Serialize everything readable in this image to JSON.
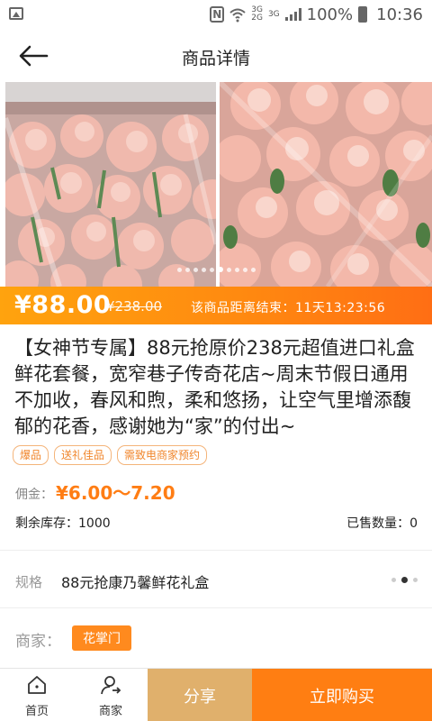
{
  "status_bar": {
    "network": [
      "3G",
      "3G",
      "2G"
    ],
    "battery": "100%",
    "time": "10:36"
  },
  "header": {
    "title": "商品详情"
  },
  "price": {
    "current": "¥88.00",
    "original": "¥238.00",
    "countdown": "该商品距离结束：11天13:23:56"
  },
  "product": {
    "title": "【女神节专属】88元抢原价238元超值进口礼盒鲜花套餐，宽窄巷子传奇花店~周末节假日通用不加收，春风和煦，柔和悠扬，让空气里增添馥郁的花香，感谢她为“家”的付出~",
    "tags": [
      "爆品",
      "送礼佳品",
      "需致电商家预约"
    ],
    "commission_label": "佣金：",
    "commission_value": "¥6.00～7.20",
    "stock": "剩余库存：1000",
    "sold": "已售数量：0"
  },
  "spec": {
    "label": "规格",
    "value": "88元抢康乃馨鲜花礼盒"
  },
  "merchant": {
    "label": "商家：",
    "name": "花掌门"
  },
  "bottom_bar": {
    "home_label": "首页",
    "shop_label": "商家",
    "share_label": "分享",
    "buy_label": "立即购买"
  },
  "colors": {
    "accent": "#ff7e12",
    "share": "#e0b06c",
    "price_bar_start": "#ffa30e"
  }
}
